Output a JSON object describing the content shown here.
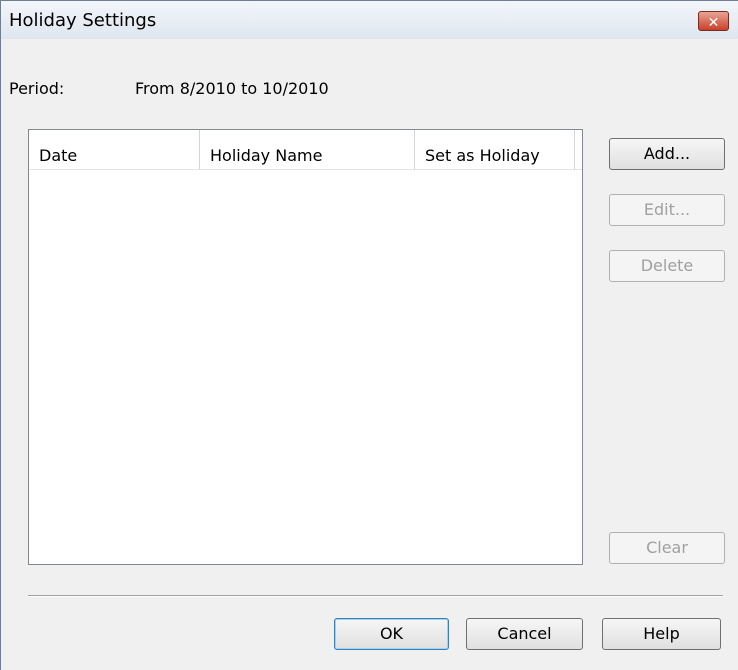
{
  "window": {
    "title": "Holiday Settings",
    "close_glyph": "✕"
  },
  "period": {
    "label": "Period:",
    "value": "From 8/2010 to 10/2010"
  },
  "table": {
    "columns": [
      "Date",
      "Holiday Name",
      "Set as Holiday"
    ],
    "rows": []
  },
  "side_buttons": {
    "add": "Add...",
    "edit": "Edit...",
    "delete": "Delete",
    "clear": "Clear"
  },
  "footer_buttons": {
    "ok": "OK",
    "cancel": "Cancel",
    "help": "Help"
  }
}
